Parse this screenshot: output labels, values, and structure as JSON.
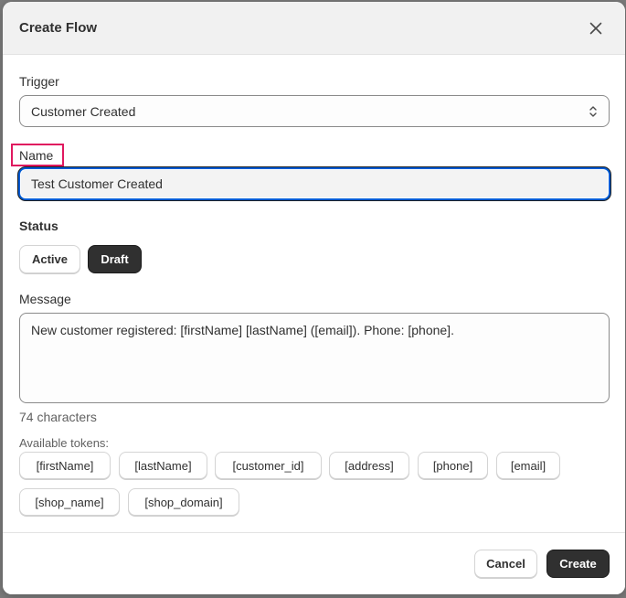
{
  "modal": {
    "title": "Create Flow"
  },
  "trigger": {
    "label": "Trigger",
    "value": "Customer Created"
  },
  "name": {
    "label": "Name",
    "value": "Test Customer Created"
  },
  "status": {
    "label": "Status",
    "options": [
      "Active",
      "Draft"
    ],
    "selected": "Draft"
  },
  "message": {
    "label": "Message",
    "value": "New customer registered: [firstName] [lastName] ([email]). Phone: [phone].",
    "char_count": "74 characters"
  },
  "tokens": {
    "label": "Available tokens:",
    "items": [
      "[firstName]",
      "[lastName]",
      "[customer_id]",
      "[address]",
      "[phone]",
      "[email]",
      "[shop_name]",
      "[shop_domain]"
    ]
  },
  "footer": {
    "cancel_label": "Cancel",
    "create_label": "Create"
  },
  "icons": {
    "close": "close-icon",
    "select": "chevron-up-down-icon"
  },
  "colors": {
    "primary_button": "#303030",
    "focus_ring": "#005bd3",
    "highlight": "#e0195f"
  }
}
